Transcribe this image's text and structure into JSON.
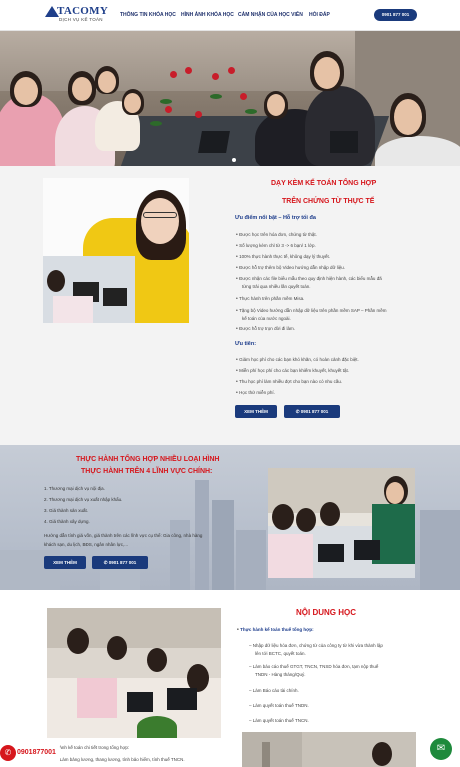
{
  "header": {
    "logo_name": "TACOMY",
    "logo_sub": "DỊCH VỤ KẾ TOÁN",
    "nav": [
      "THÔNG TIN KHÓA HỌC",
      "HÌNH ẢNH KHÓA HỌC",
      "CẢM NHẬN CỦA HỌC VIÊN",
      "HỎI ĐÁP"
    ],
    "phone": "0901 877 001"
  },
  "colors": {
    "brand": "#1a3a7c",
    "accent_red": "#d6161c",
    "chat_green": "#1e8a3c"
  },
  "section1": {
    "title1": "DẠY KÈM KẾ TOÁN TỔNG HỢP",
    "title2": "TRÊN CHỨNG TỪ THỰC TẾ",
    "advantages_heading": "Ưu điểm nổi bật – Hỗ trợ tối đa",
    "advantages": [
      "Được học trên hóa đơn, chứng từ thật.",
      "Số lượng kèm chỉ từ 3 -> 6 bạn/ 1 lớp.",
      "100% thực hành thực tế, không dạy lý thuyết.",
      "Được hỗ trợ thêm bộ Video hướng dẫn nhập dữ liệu.",
      "Được nhận các file biểu mẫu theo quy định hiện hành, các biểu mẫu đã",
      "từng trải qua nhiều lần quyết toán.",
      "Thực hành trên phần mềm Misa.",
      "Tặng bộ Video hướng dẫn nhập dữ liệu trên phần mềm SAP – Phần mềm",
      "kế toán của nước ngoài.",
      "Được hỗ trợ trọn đời đi làm."
    ],
    "incentives_heading": "Ưu tiên:",
    "incentives": [
      "Giảm học phí cho các bạn khó khăn, có hoàn cảnh đặc biệt.",
      "Miễn phí học phí cho các bạn khiếm khuyết, khuyết tật.",
      "Thu học phí làm nhiều đợt cho bạn nào có nhu cầu.",
      "Học thử miễn phí."
    ],
    "btn_more": "XEM THÊM",
    "btn_phone": "0901 877 001"
  },
  "section2": {
    "title1": "THỰC HÀNH TỔNG HỢP NHIỀU LOẠI HÌNH",
    "title2": "THỰC HÀNH TRÊN 4 LĨNH VỰC CHÍNH:",
    "items": [
      "1. Thương mại dịch vụ nội địa.",
      "2. Thương mại dịch vụ xuất nhập khẩu.",
      "3. Giá thành sản xuất.",
      "4. Giá thành xây dựng."
    ],
    "note1": "Hướng dẫn tính giá vốn, giá thành trên các lĩnh vực cụ thể: Gia công, nhà hàng",
    "note2": "khách sạn, du lịch, BĐS, ngân nhân lực,...",
    "btn_more": "XEM THÊM",
    "btn_phone": "0901 877 001"
  },
  "section3": {
    "title": "NỘI DUNG HỌC",
    "sub_heading": "Thực hành kế toán thuế tổng hợp:",
    "lines": [
      "Nhập dữ liệu hóa đơn, chứng từ của công ty từ khi vừa thành lập",
      "lên tới BCTC, quyết toán.",
      "Làm báo cáo thuế GTGT, TNCN, TNSD hóa đơn, tạm nộp thuế",
      "TNDN - Hàng tháng/Quý.",
      "Làm Báo cáo tài chính.",
      "Làm quyết toán thuế TNDN.",
      "Làm quyết toán thuế TNCN."
    ],
    "bottom_bullet1": "Thực hành kế toán chi tiết trong tổng hợp:",
    "bottom_bullet2": "Làm bảng lương, thang lương, tính bảo hiểm, tính thuế TNCN."
  },
  "floating_phone": "0901877001"
}
